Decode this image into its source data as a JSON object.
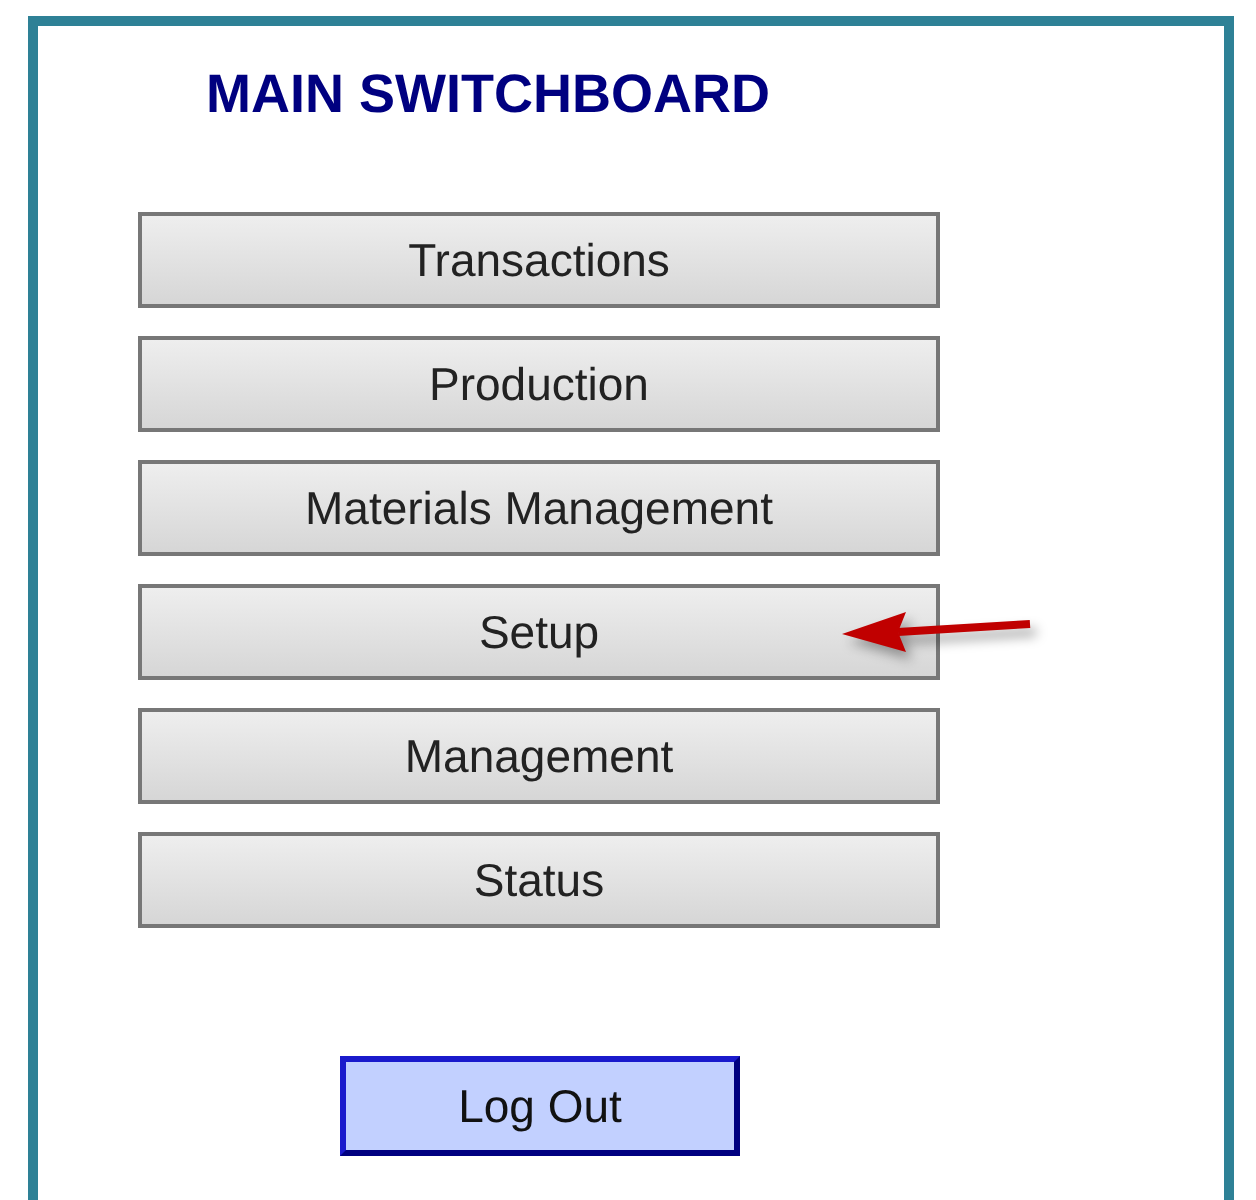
{
  "title": "MAIN SWITCHBOARD",
  "menu_buttons": [
    {
      "label": "Transactions"
    },
    {
      "label": "Production"
    },
    {
      "label": "Materials Management"
    },
    {
      "label": "Setup"
    },
    {
      "label": "Management"
    },
    {
      "label": "Status"
    }
  ],
  "logout_button": {
    "label": "Log Out"
  }
}
